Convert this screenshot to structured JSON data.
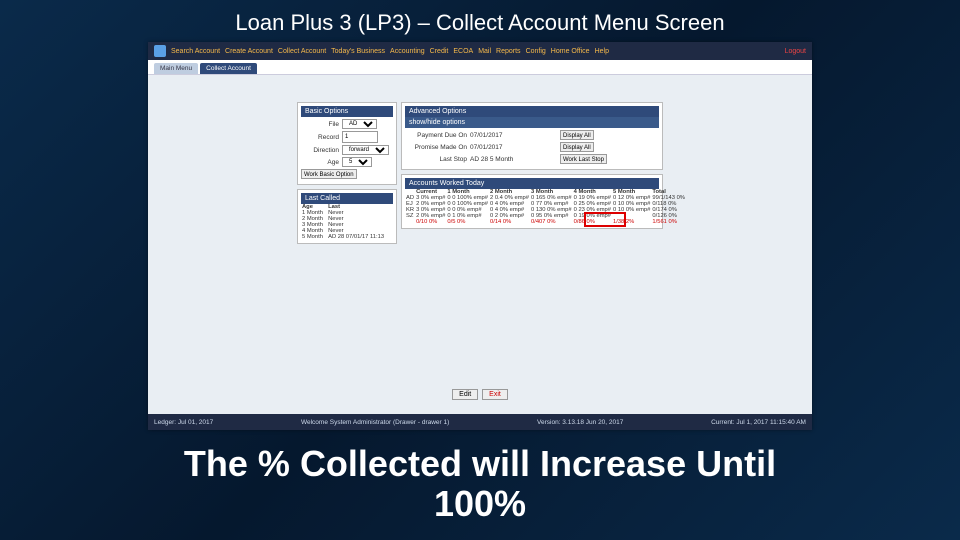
{
  "slide": {
    "title": "Loan Plus 3 (LP3) – Collect Account Menu Screen",
    "caption1": "The % Collected will Increase Until",
    "caption2": "100%"
  },
  "header": {
    "nav": [
      "Search Account",
      "Create Account",
      "Collect Account",
      "Today's Business",
      "Accounting",
      "Credit",
      "ECOA",
      "Mail",
      "Reports",
      "Config",
      "Home Office",
      "Help"
    ],
    "logout": "Logout"
  },
  "tabs": {
    "inactive": "Main Menu",
    "active": "Collect Account"
  },
  "basic": {
    "title": "Basic Options",
    "file_label": "File",
    "file_value": "AD",
    "record_label": "Record",
    "record_value": "1",
    "direction_label": "Direction",
    "direction_value": "forward",
    "age_label": "Age",
    "age_value": "5",
    "work_btn": "Work Basic Option"
  },
  "adv": {
    "title": "Advanced Options",
    "showhide": "show/hide options",
    "rows": [
      {
        "label": "Payment Due On",
        "value": "07/01/2017",
        "btn": "Display All"
      },
      {
        "label": "Promise Made On",
        "value": "07/01/2017",
        "btn": "Display All"
      },
      {
        "label": "Last Stop",
        "value": "AD 28 5 Month",
        "btn": "Work Last Stop"
      }
    ]
  },
  "lastcalled": {
    "title": "Last Called",
    "header": [
      "Age",
      "Last"
    ],
    "rows": [
      [
        "1 Month",
        "Never"
      ],
      [
        "2 Month",
        "Never"
      ],
      [
        "3 Month",
        "Never"
      ],
      [
        "4 Month",
        "Never"
      ],
      [
        "5 Month",
        "AD 28 07/01/17 11:13"
      ]
    ]
  },
  "worked": {
    "title": "Accounts Worked Today",
    "header": [
      "",
      "Current",
      "1 Month",
      "2 Month",
      "3 Month",
      "4 Month",
      "5 Month",
      "Total"
    ],
    "rows": [
      [
        "AD",
        "3 0% emp#",
        "0 0 100% emp#",
        "2 0.4 0% emp#",
        "0 165 0% emp#",
        "0 19 0% emp#",
        "0 12 0% emp#",
        "99/1/143 0%"
      ],
      [
        "EJ",
        "2 0% emp#",
        "0 0 100% emp#",
        "0 4 0% emp#",
        "0 77 0% emp#",
        "0  25 0% emp#",
        "0 10 0% emp#",
        "0/118 0%"
      ],
      [
        "KR",
        "3 0% emp#",
        "0 0 0% emp#",
        "0  4 0% emp#",
        "0 130 0% emp#",
        "0 23 0% emp#",
        "0 10 0% emp#",
        "0/174 0%"
      ],
      [
        "SZ",
        "2 0% emp#",
        "0 1 0% emp#",
        "0  2 0% emp#",
        "0 95 0% emp#",
        "0  19 0% emp#",
        "",
        "0/126 0%"
      ]
    ],
    "totals": [
      "",
      "0/10 0%",
      "0/5 0%",
      "0/14 0%",
      "0/407 0%",
      "0/86 0%",
      "1/38 2%",
      "1/561 0%"
    ]
  },
  "bottom": {
    "edit": "Edit",
    "exit": "Exit"
  },
  "footer": {
    "ledger": "Ledger: Jul 01, 2017",
    "welcome": "Welcome System Administrator (Drawer - drawer 1)",
    "version": "Version: 3.13.18 Jun 20, 2017",
    "current": "Current: Jul 1, 2017 11:15:40 AM"
  }
}
